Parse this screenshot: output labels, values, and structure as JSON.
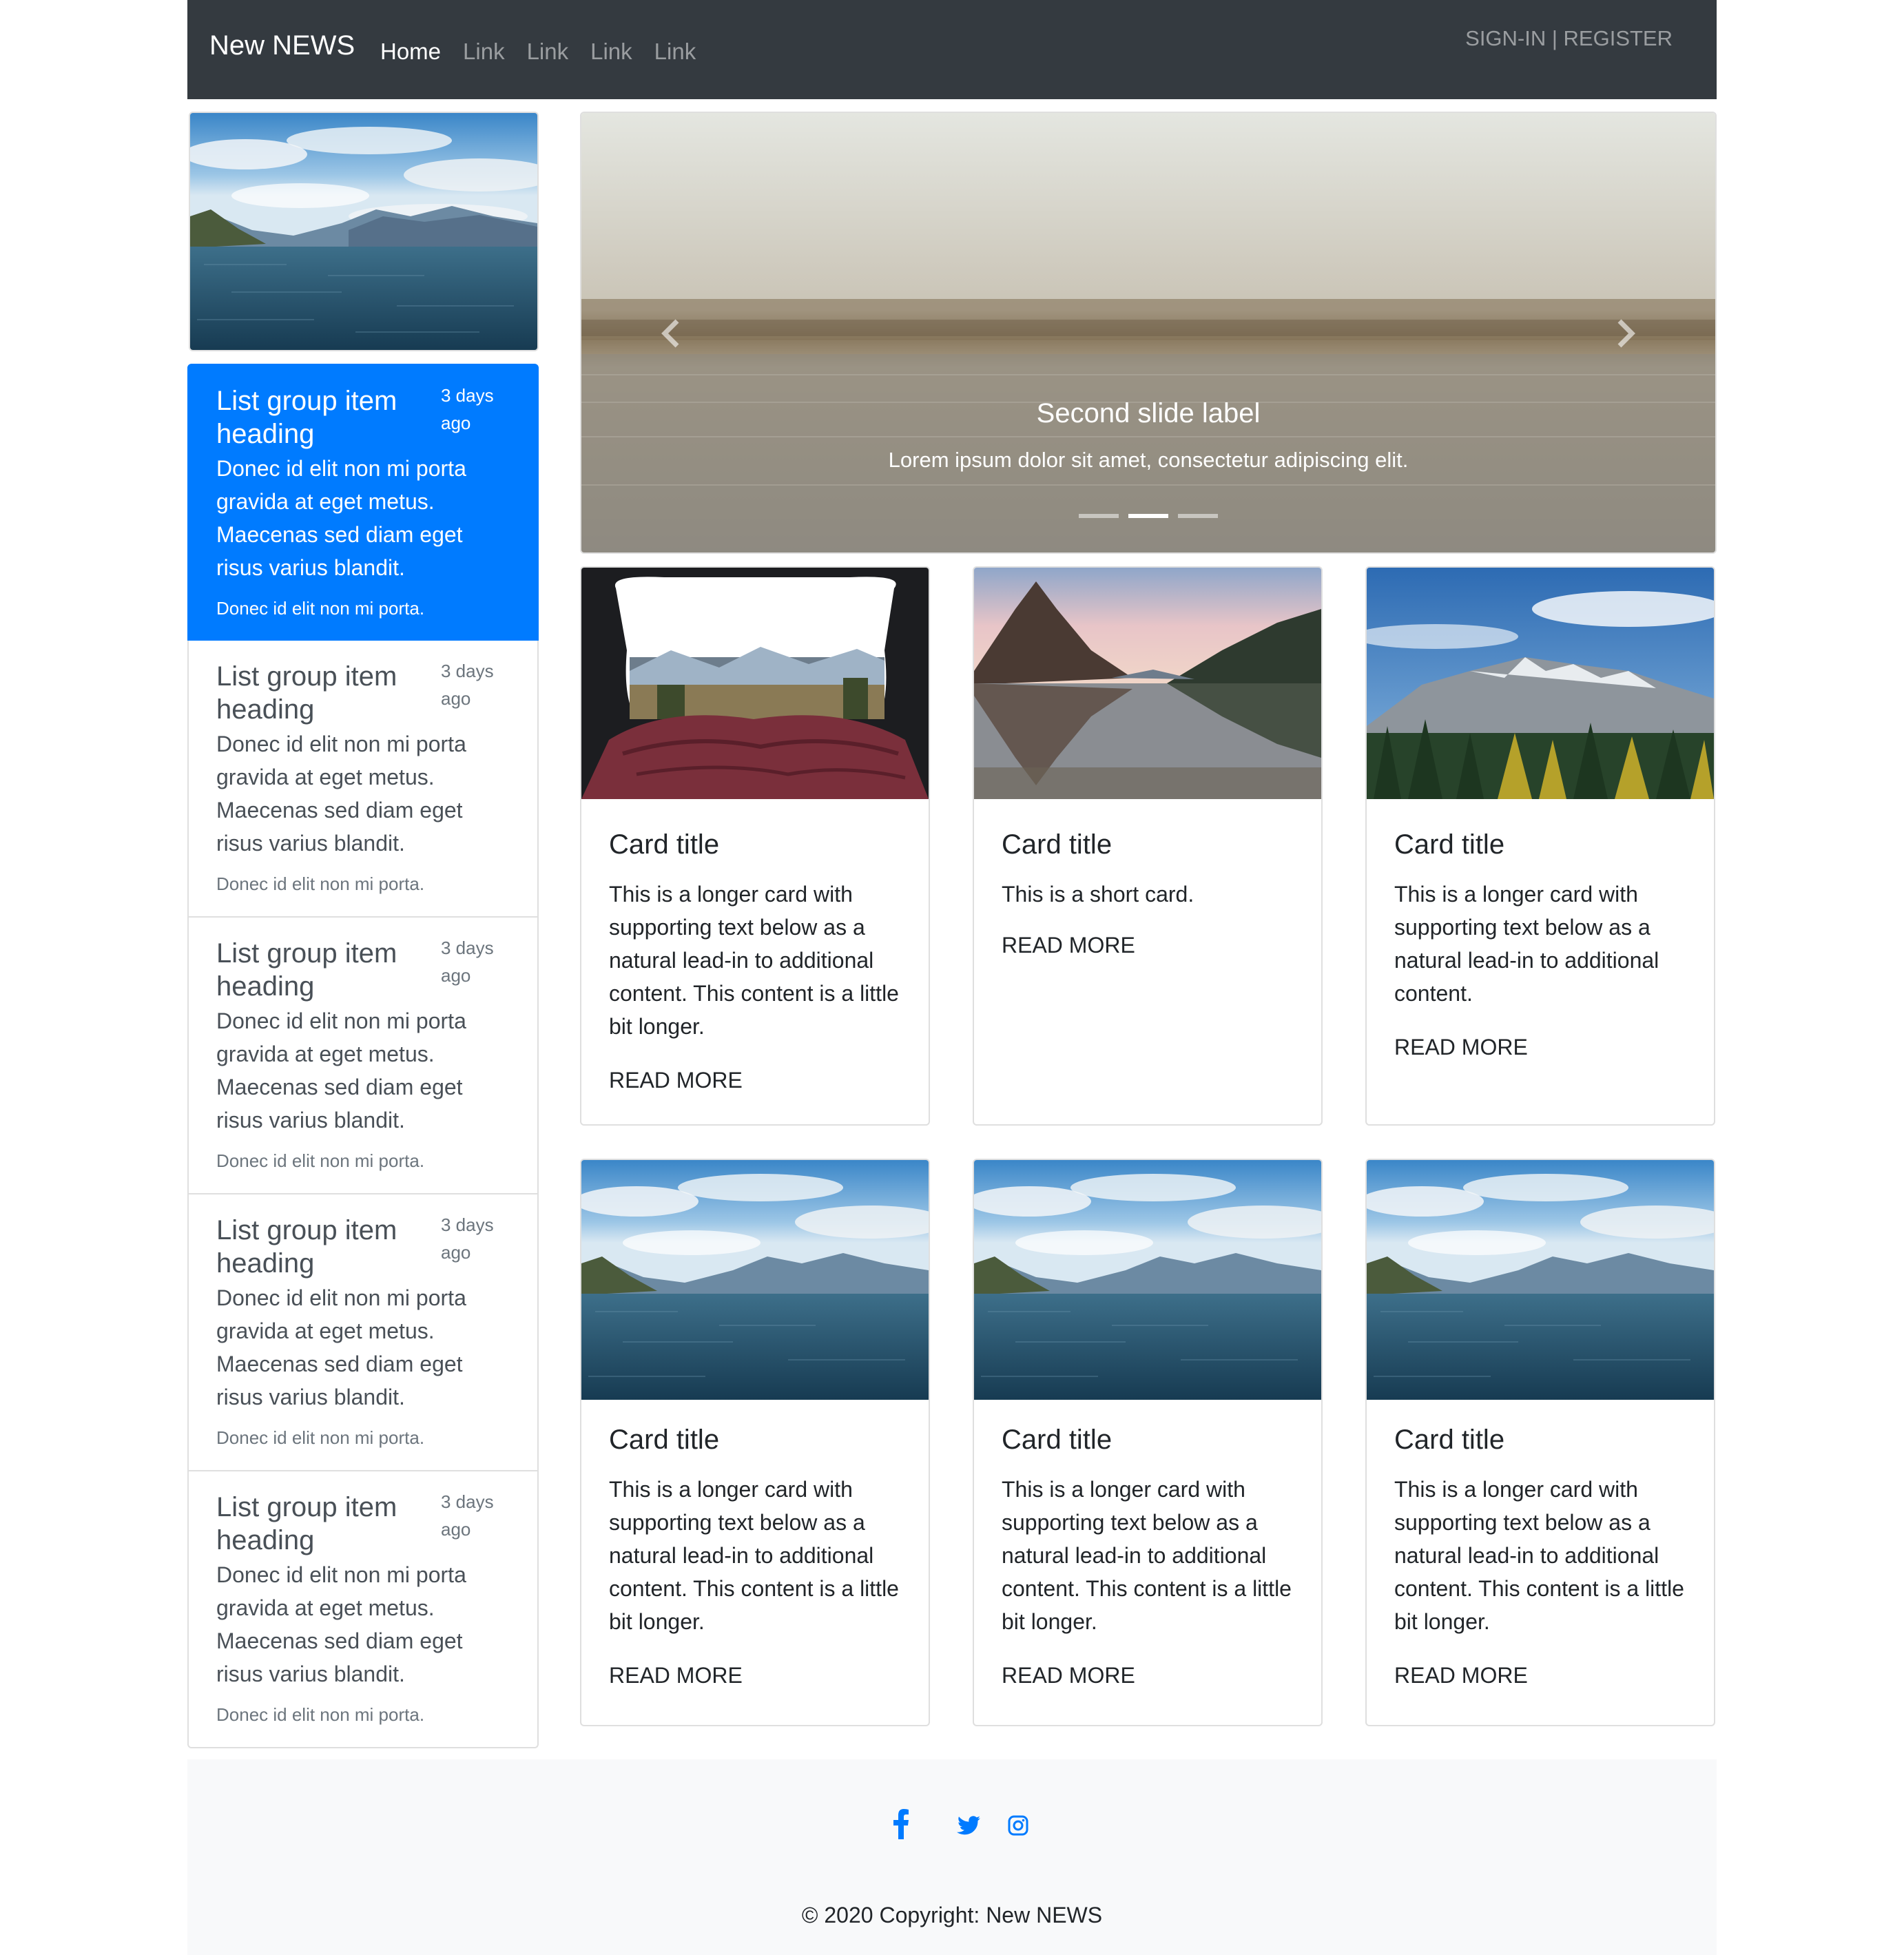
{
  "navbar": {
    "brand": "New NEWS",
    "links": [
      {
        "label": "Home",
        "active": true
      },
      {
        "label": "Link",
        "active": false
      },
      {
        "label": "Link",
        "active": false
      },
      {
        "label": "Link",
        "active": false
      },
      {
        "label": "Link",
        "active": false
      }
    ],
    "account": "SIGN-IN | REGISTER"
  },
  "sidebar": {
    "list_items": [
      {
        "heading": "List group item heading",
        "time": "3 days ago",
        "text": "Donec id elit non mi porta gravida at eget metus. Maecenas sed diam eget risus varius blandit.",
        "small": "Donec id elit non mi porta.",
        "active": true
      },
      {
        "heading": "List group item heading",
        "time": "3 days ago",
        "text": "Donec id elit non mi porta gravida at eget metus. Maecenas sed diam eget risus varius blandit.",
        "small": "Donec id elit non mi porta.",
        "active": false
      },
      {
        "heading": "List group item heading",
        "time": "3 days ago",
        "text": "Donec id elit non mi porta gravida at eget metus. Maecenas sed diam eget risus varius blandit.",
        "small": "Donec id elit non mi porta.",
        "active": false
      },
      {
        "heading": "List group item heading",
        "time": "3 days ago",
        "text": "Donec id elit non mi porta gravida at eget metus. Maecenas sed diam eget risus varius blandit.",
        "small": "Donec id elit non mi porta.",
        "active": false
      },
      {
        "heading": "List group item heading",
        "time": "3 days ago",
        "text": "Donec id elit non mi porta gravida at eget metus. Maecenas sed diam eget risus varius blandit.",
        "small": "Donec id elit non mi porta.",
        "active": false
      }
    ]
  },
  "carousel": {
    "caption_title": "Second slide label",
    "caption_text": "Lorem ipsum dolor sit amet, consectetur adipiscing elit.",
    "prev_icon": "chevron-left-icon",
    "next_icon": "chevron-right-icon",
    "slide_count": 3,
    "active_slide": 2
  },
  "cards": [
    {
      "image": "car-trunk-mountains",
      "title": "Card title",
      "text": "This is a longer card with supporting text below as a natural lead-in to additional content. This content is a little bit longer.",
      "link": "READ MORE"
    },
    {
      "image": "mountain-lake-reflection",
      "title": "Card title",
      "text": "This is a short card.",
      "link": "READ MORE"
    },
    {
      "image": "snowy-ridge-forest",
      "title": "Card title",
      "text": "This is a longer card with supporting text below as a natural lead-in to additional content.",
      "link": "READ MORE"
    },
    {
      "image": "lake-clouds",
      "title": "Card title",
      "text": "This is a longer card with supporting text below as a natural lead-in to additional content. This content is a little bit longer.",
      "link": "READ MORE"
    },
    {
      "image": "lake-clouds",
      "title": "Card title",
      "text": "This is a longer card with supporting text below as a natural lead-in to additional content. This content is a little bit longer.",
      "link": "READ MORE"
    },
    {
      "image": "lake-clouds",
      "title": "Card title",
      "text": "This is a longer card with supporting text below as a natural lead-in to additional content. This content is a little bit longer.",
      "link": "READ MORE"
    }
  ],
  "footer": {
    "social_icons": [
      "facebook-icon",
      "twitter-icon",
      "instagram-icon"
    ],
    "copyright_prefix": "© 2020 Copyright: ",
    "copyright_brand": "New NEWS"
  },
  "colors": {
    "navbar_bg": "#343a40",
    "primary": "#007bff",
    "footer_bg": "#f8f9fa",
    "border": "#dfdfdf"
  }
}
